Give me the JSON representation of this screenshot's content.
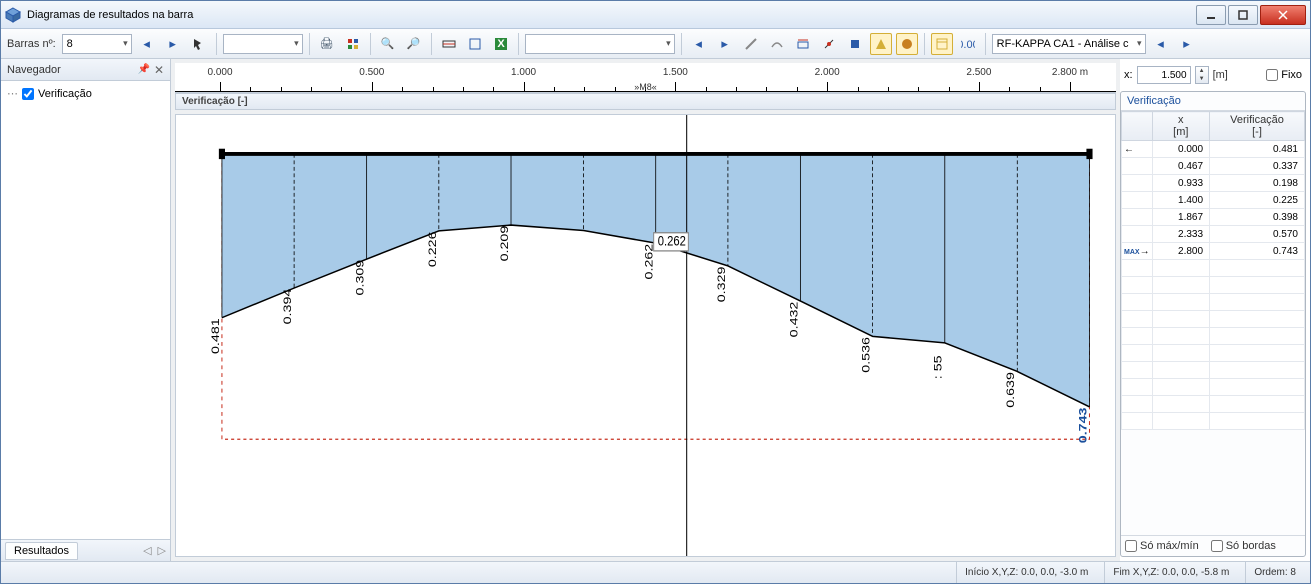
{
  "window": {
    "title": "Diagramas de resultados na barra"
  },
  "toolbar": {
    "bar_label": "Barras nº:",
    "bar_value": "8",
    "module": "RF-KAPPA CA1 - Análise c"
  },
  "navigator": {
    "title": "Navegador",
    "tree_item": "Verificação",
    "results_tab": "Resultados"
  },
  "ruler": {
    "ticks": [
      "0.000",
      "0.500",
      "1.000",
      "1.500",
      "2.000",
      "2.500",
      "2.800 m"
    ],
    "marker": "»M8«"
  },
  "plot": {
    "title": "Verificação [-]",
    "max_label": "0.743"
  },
  "chart_data": {
    "type": "area",
    "title": "Verificação [-]",
    "xlabel": "x [m]",
    "ylabel": "Verificação",
    "xlim": [
      0,
      2.8
    ],
    "ylim": [
      0,
      0.8
    ],
    "x": [
      0.0,
      0.233,
      0.467,
      0.7,
      0.933,
      1.167,
      1.4,
      1.633,
      1.867,
      2.1,
      2.333,
      2.567,
      2.8
    ],
    "values": [
      0.481,
      0.394,
      0.309,
      0.226,
      0.209,
      0.225,
      0.262,
      0.329,
      0.432,
      0.536,
      0.555,
      0.639,
      0.743
    ],
    "labels": [
      "0.481",
      "0.394",
      "0.309",
      "0.226",
      "0.209",
      "",
      "0.262",
      "0.329",
      "0.432",
      "0.536",
      ": 55",
      "0.639",
      "0.743"
    ]
  },
  "xinput": {
    "label": "x:",
    "value": "1.500",
    "unit": "[m]",
    "fixo": "Fixo"
  },
  "table": {
    "title": "Verificação",
    "col_x": "x",
    "col_x_unit": "[m]",
    "col_v": "Verificação",
    "col_v_unit": "[-]",
    "rows": [
      {
        "mark": "←",
        "x": "0.000",
        "v": "0.481"
      },
      {
        "mark": "",
        "x": "0.467",
        "v": "0.337"
      },
      {
        "mark": "",
        "x": "0.933",
        "v": "0.198"
      },
      {
        "mark": "",
        "x": "1.400",
        "v": "0.225"
      },
      {
        "mark": "",
        "x": "1.867",
        "v": "0.398"
      },
      {
        "mark": "",
        "x": "2.333",
        "v": "0.570"
      },
      {
        "mark": "MAX→",
        "x": "2.800",
        "v": "0.743"
      }
    ],
    "only_maxmin": "Só máx/mín",
    "only_edges": "Só bordas"
  },
  "status": {
    "start": "Início X,Y,Z:  0.0, 0.0, -3.0 m",
    "end": "Fim X,Y,Z:  0.0, 0.0, -5.8 m",
    "order": "Ordem:  8"
  }
}
